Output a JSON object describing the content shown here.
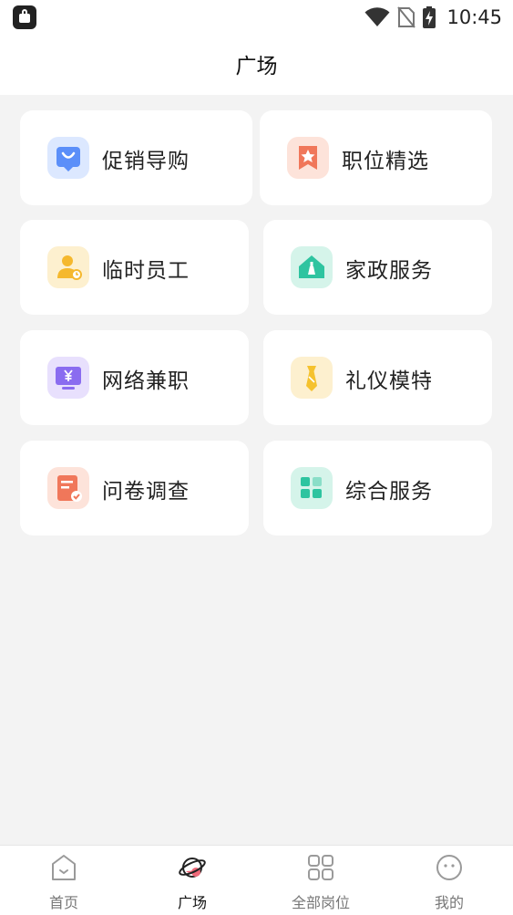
{
  "status_bar": {
    "time": "10:45"
  },
  "header": {
    "title": "广场"
  },
  "categories": [
    {
      "label": "促销导购",
      "icon": "shopping-bag-icon",
      "color": "#5b8ff9"
    },
    {
      "label": "职位精选",
      "icon": "bookmark-star-icon",
      "color": "#f0775a"
    },
    {
      "label": "临时员工",
      "icon": "worker-icon",
      "color": "#f5b82e"
    },
    {
      "label": "家政服务",
      "icon": "house-icon",
      "color": "#2ec4a0"
    },
    {
      "label": "网络兼职",
      "icon": "computer-yen-icon",
      "color": "#8a6cf0"
    },
    {
      "label": "礼仪模特",
      "icon": "tie-icon",
      "color": "#f5c22e"
    },
    {
      "label": "问卷调查",
      "icon": "survey-icon",
      "color": "#f0775a"
    },
    {
      "label": "综合服务",
      "icon": "grid-blocks-icon",
      "color": "#2ec4a0"
    }
  ],
  "bottom_nav": [
    {
      "label": "首页",
      "icon": "home-icon",
      "active": false
    },
    {
      "label": "广场",
      "icon": "planet-icon",
      "active": true
    },
    {
      "label": "全部岗位",
      "icon": "apps-grid-icon",
      "active": false
    },
    {
      "label": "我的",
      "icon": "face-icon",
      "active": false
    }
  ]
}
